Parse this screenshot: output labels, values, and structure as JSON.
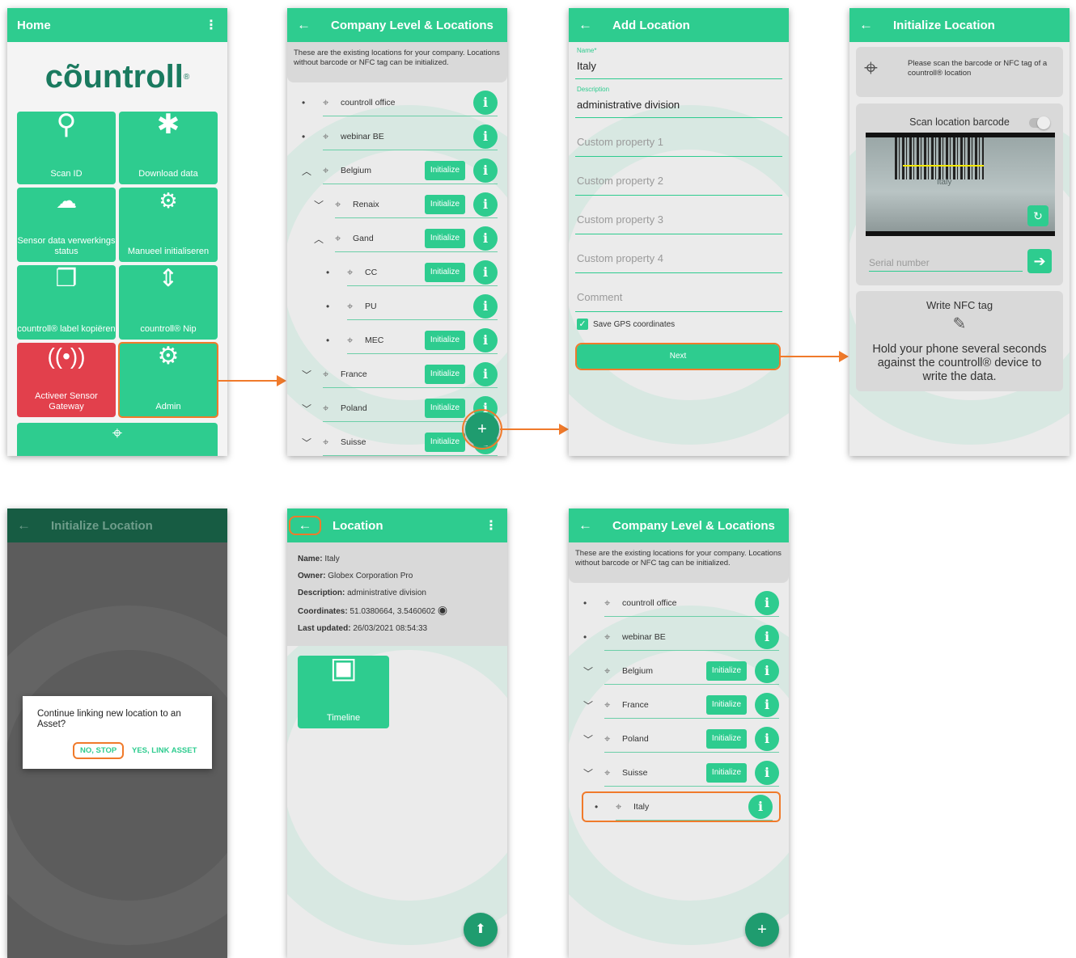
{
  "home": {
    "title": "Home",
    "logo": "cõuntroll",
    "tiles": [
      {
        "label": "Scan ID",
        "icon": "search-icon"
      },
      {
        "label": "Download data",
        "icon": "bluetooth-icon"
      },
      {
        "label": "Sensor data verwerkings status",
        "icon": "cloud-sync-icon"
      },
      {
        "label": "Manueel initialiseren",
        "icon": "gear-hand-icon"
      },
      {
        "label": "countroll® label kopiëren",
        "icon": "copy-icon"
      },
      {
        "label": "countroll® Nip",
        "icon": "nip-icon"
      },
      {
        "label": "Activeer Sensor Gateway",
        "icon": "antenna-icon"
      },
      {
        "label": "Admin",
        "icon": "admin-gears-icon"
      }
    ]
  },
  "locations1": {
    "title": "Company Level & Locations",
    "note": "These are the existing locations for your company. Locations without barcode or NFC tag can be initialized.",
    "init_label": "Initialize",
    "rows": [
      {
        "name": "countroll office",
        "level": 0,
        "marker": "•",
        "init": false
      },
      {
        "name": "webinar BE",
        "level": 0,
        "marker": "•",
        "init": false
      },
      {
        "name": "Belgium",
        "level": 0,
        "marker": "^",
        "init": true
      },
      {
        "name": "Renaix",
        "level": 1,
        "marker": "v",
        "init": true
      },
      {
        "name": "Gand",
        "level": 1,
        "marker": "^",
        "init": true
      },
      {
        "name": "CC",
        "level": 2,
        "marker": "•",
        "init": true
      },
      {
        "name": "PU",
        "level": 2,
        "marker": "•",
        "init": false
      },
      {
        "name": "MEC",
        "level": 2,
        "marker": "•",
        "init": true
      },
      {
        "name": "France",
        "level": 0,
        "marker": "v",
        "init": true
      },
      {
        "name": "Poland",
        "level": 0,
        "marker": "v",
        "init": true
      },
      {
        "name": "Suisse",
        "level": 0,
        "marker": "v",
        "init": true
      }
    ],
    "fab": "+"
  },
  "add_location": {
    "title": "Add Location",
    "name_label": "Name*",
    "name_value": "Italy",
    "desc_label": "Description",
    "desc_value": "administrative division",
    "placeholders": [
      "Custom property 1",
      "Custom property 2",
      "Custom property 3",
      "Custom property 4",
      "Comment"
    ],
    "gps_label": "Save GPS coordinates",
    "next_label": "Next"
  },
  "init_location": {
    "title": "Initialize Location",
    "scan_prompt": "Please scan the barcode or NFC tag of a countroll® location",
    "scan_barcode_label": "Scan location barcode",
    "barcode_text": "Italy",
    "serial_placeholder": "Serial number",
    "nfc_title": "Write NFC tag",
    "nfc_text": "Hold your phone several seconds against the countroll® device to write the data."
  },
  "dialog": {
    "title": "Initialize Location",
    "message": "Continue linking new location to an Asset?",
    "no_label": "NO, STOP",
    "yes_label": "YES, LINK ASSET"
  },
  "location_detail": {
    "title": "Location",
    "name_k": "Name:",
    "name_v": "Italy",
    "owner_k": "Owner:",
    "owner_v": "Globex Corporation Pro",
    "desc_k": "Description:",
    "desc_v": "administrative division",
    "coord_k": "Coordinates:",
    "coord_v": "51.0380664, 3.5460602",
    "upd_k": "Last updated:",
    "upd_v": "26/03/2021 08:54:33",
    "timeline_label": "Timeline"
  },
  "locations2": {
    "title": "Company Level & Locations",
    "note": "These are the existing locations for your company. Locations without barcode or NFC tag can be initialized.",
    "init_label": "Initialize",
    "rows": [
      {
        "name": "countroll office",
        "marker": "•",
        "init": false
      },
      {
        "name": "webinar BE",
        "marker": "•",
        "init": false
      },
      {
        "name": "Belgium",
        "marker": "v",
        "init": true
      },
      {
        "name": "France",
        "marker": "v",
        "init": true
      },
      {
        "name": "Poland",
        "marker": "v",
        "init": true
      },
      {
        "name": "Suisse",
        "marker": "v",
        "init": true
      },
      {
        "name": "Italy",
        "marker": "•",
        "init": false
      }
    ],
    "fab": "+"
  },
  "colors": {
    "accent": "#2ecc8f",
    "highlight": "#f07a2b",
    "danger": "#e2404c"
  }
}
